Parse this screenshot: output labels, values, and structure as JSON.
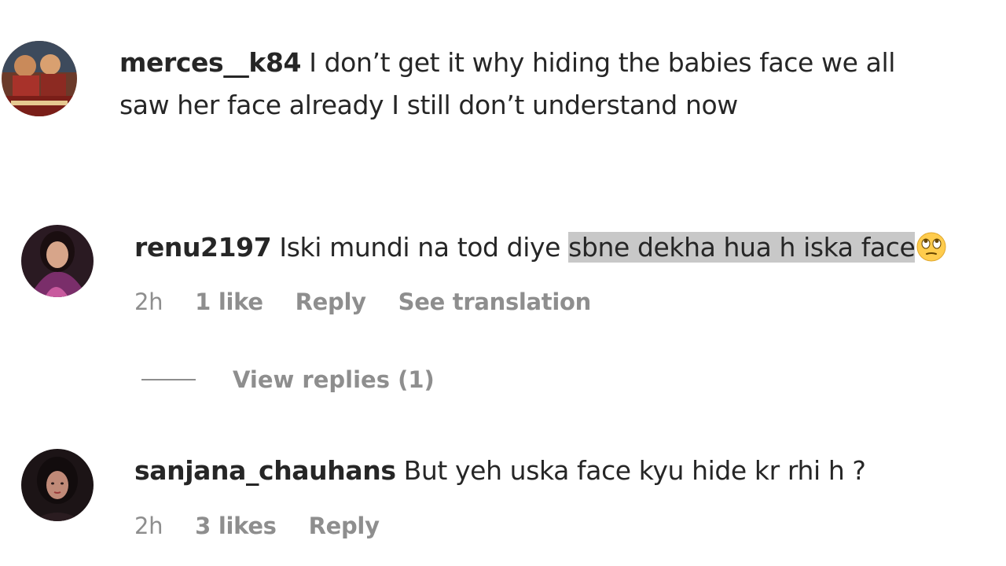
{
  "comments": [
    {
      "username": "merces__k84",
      "text_line1": "I don’t get it why hiding the babies face we all",
      "text_line2": "saw her face already I still don’t understand now"
    },
    {
      "username": "renu2197",
      "text_plain": "Iski mundi na tod diye ",
      "text_highlight": "sbne dekha hua h iska face",
      "emoji": "face-with-rolling-eyes-icon",
      "time": "2h",
      "likes": "1 like",
      "reply": "Reply",
      "translate": "See translation",
      "view_replies": "View replies (1)"
    },
    {
      "username": "sanjana_chauhans",
      "text_plain": "But yeh uska face kyu hide kr rhi h ?",
      "time": "2h",
      "likes": "3 likes",
      "reply": "Reply"
    }
  ],
  "colors": {
    "text": "#262626",
    "secondary": "#8e8e8e",
    "highlight": "#c8c8c8"
  }
}
